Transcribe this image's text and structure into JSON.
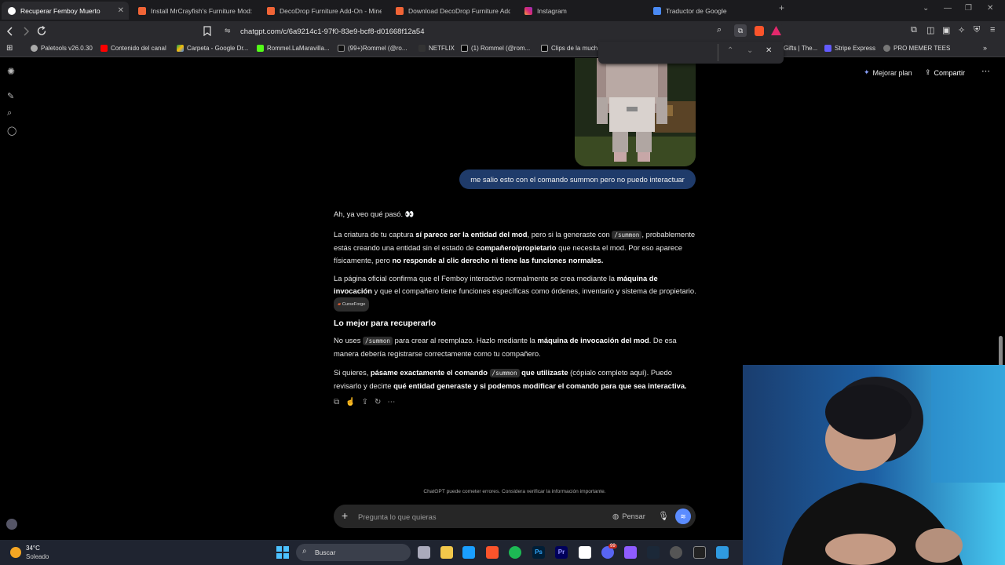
{
  "tabs": [
    {
      "label": "Recuperar Femboy Muerto",
      "active": true
    },
    {
      "label": "Install MrCrayfish's Furniture Mod: Re",
      "active": false
    },
    {
      "label": "DecoDrop Furniture Add-On - Minec",
      "active": false
    },
    {
      "label": "Download DecoDrop Furniture Add-",
      "active": false
    },
    {
      "label": "Instagram",
      "active": false
    },
    {
      "label": "Traductor de Google",
      "active": false
    }
  ],
  "new_tab": "+",
  "url": "chatgpt.com/c/6a9214c1-97f0-83e9-bcf8-d01668f12a54",
  "bookmarks": [
    "Paletools v26.0.30",
    "Contenido del canal",
    "Carpeta - Google Dr...",
    "Rommel.LaMaravilla...",
    "(99+)Rommel (@ro...",
    "NETFLIX",
    "(1) Rommel (@rom...",
    "Clips de la much",
    "Gifts | The...",
    "Stripe Express",
    "PRO MEMER TEES"
  ],
  "header": {
    "upgrade": "Mejorar plan",
    "share": "Compartir"
  },
  "user_message": "me salio esto con el comando summon pero no puedo interactuar",
  "assistant": {
    "p1": "Ah, ya veo qué pasó. 👀",
    "p2a": "La criatura de tu captura ",
    "p2b": "sí parece ser la entidad del mod",
    "p2c": ", pero si la generaste con ",
    "p2code": "/summon",
    "p2d": ", probablemente estás creando una entidad sin el estado de ",
    "p2e": "compañero/propietario",
    "p2f": " que necesita el mod. Por eso aparece físicamente, pero ",
    "p2g": "no responde al clic derecho ni tiene las funciones normales.",
    "p3a": "La página oficial confirma que el Femboy interactivo normalmente se crea mediante la ",
    "p3b": "máquina de invocación",
    "p3c": " y que el compañero tiene funciones específicas como órdenes, inventario y sistema de propietario. ",
    "p3chip": "CurseForge",
    "h": "Lo mejor para recuperarlo",
    "p4a": "No uses ",
    "p4code": "/summon",
    "p4b": " para crear al reemplazo. Hazlo mediante la ",
    "p4c": "máquina de invocación del mod",
    "p4d": ". De esa manera debería registrarse correctamente como tu compañero.",
    "p5a": "Si quieres, ",
    "p5b": "pásame exactamente el comando ",
    "p5code": "/summon",
    "p5c": " que utilizaste",
    "p5d": " (cópialo completo aquí). Puedo revisarlo y decirte ",
    "p5e": "qué entidad generaste y si podemos modificar el comando para que sea interactiva."
  },
  "disclaimer": "ChatGPT puede cometer errores. Considera verificar la información importante.",
  "composer": {
    "placeholder": "Pregunta lo que quieras",
    "think": "Pensar"
  },
  "taskbar": {
    "temp": "34°C",
    "weather": "Soleado",
    "search": "Buscar",
    "badge": "99"
  },
  "colors": {
    "accent_blue": "#1f3b6a",
    "taskbar": "#1f2430",
    "tab_bar": "#1b1b1e"
  }
}
